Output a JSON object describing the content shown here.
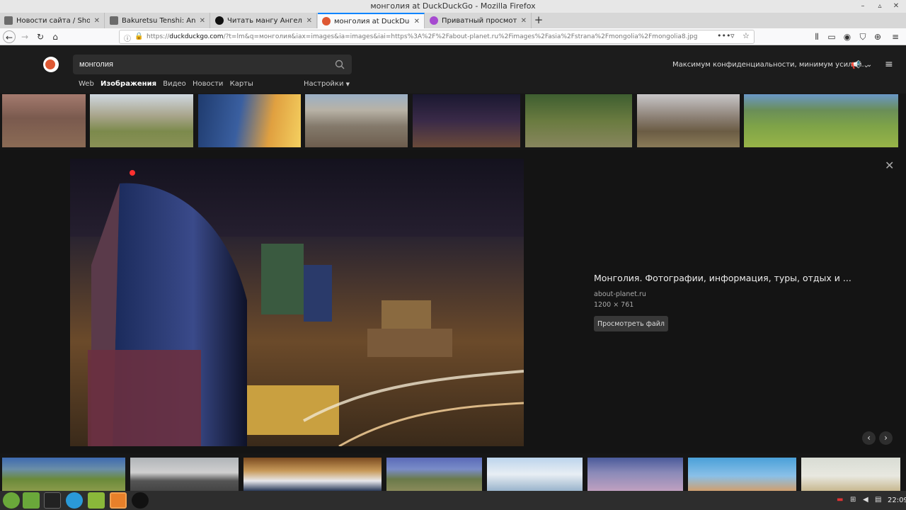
{
  "window": {
    "title": "монголия at DuckDuckGo - Mozilla Firefox"
  },
  "tabs": [
    {
      "label": "Новости сайта / Shogun_o",
      "color": "#6b6b6b"
    },
    {
      "label": "Bakuretsu Tenshi: Angel's /",
      "color": "#6b6b6b"
    },
    {
      "label": "Читать мангу Ангелы Сме",
      "color": "#111111"
    },
    {
      "label": "монголия at DuckDuckGo",
      "color": "#de5833"
    },
    {
      "label": "Приватный просмотр",
      "color": "#a64ad0"
    }
  ],
  "navbar": {
    "url_host": "duckduckgo.com",
    "url_path": "/?t=lm&q=монголия&iax=images&ia=images&iai=https%3A%2F%2Fabout-planet.ru%2Fimages%2Fasia%2Fstrana%2Fmongolia%2Fmongolia8.jpg",
    "url_prefix": "https://"
  },
  "ddg": {
    "query": "монголия",
    "tabs": [
      "Web",
      "Изображения",
      "Видео",
      "Новости",
      "Карты"
    ],
    "settings_label": "Настройки",
    "privacy_label": "Максимум конфиденциальности, минимум усилий."
  },
  "detail": {
    "title": "Монголия. Фотографии, информация, туры, отдых и ...",
    "source": "about-planet.ru",
    "dimensions": "1200 × 761",
    "view_file_label": "Просмотреть файл"
  },
  "taskbar": {
    "clock": "22:09"
  },
  "colors": {
    "ddg_orange": "#de5833",
    "firefox_accent": "#0a84ff"
  }
}
